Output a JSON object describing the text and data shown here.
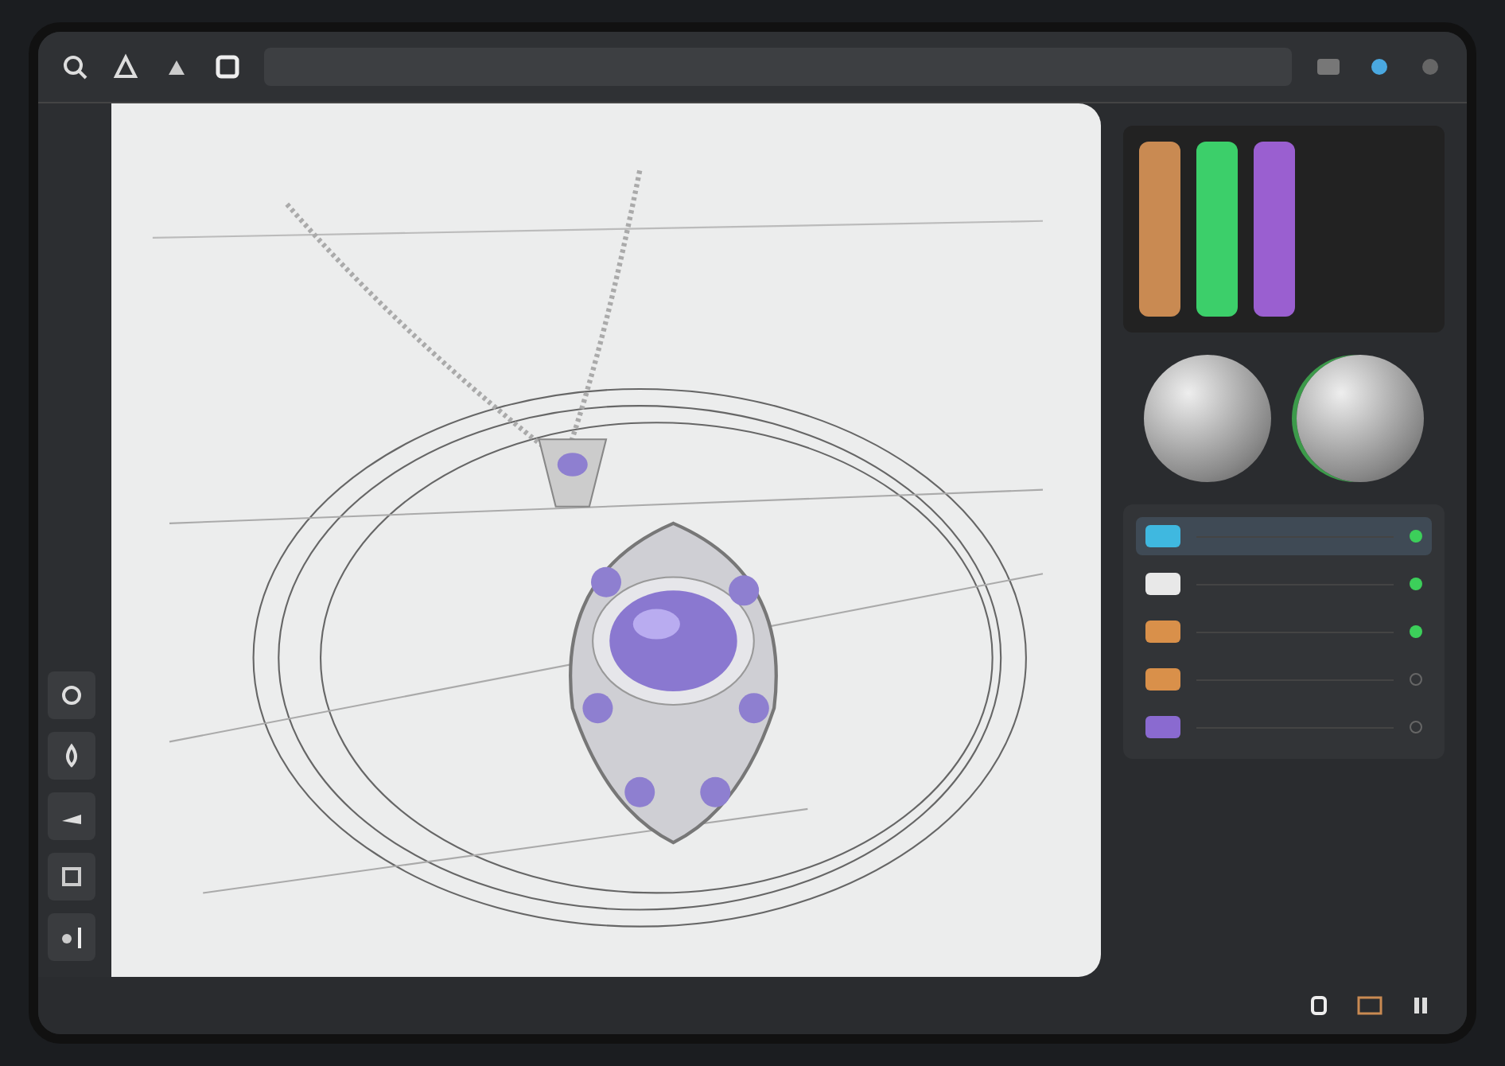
{
  "color_panel": {
    "bars": [
      {
        "color": "#c98a52"
      },
      {
        "color": "#3ccf6a"
      },
      {
        "color": "#9a5fd0"
      }
    ]
  },
  "layers": [
    {
      "color": "#3fb8e0",
      "visible": true,
      "selected": true
    },
    {
      "color": "#e8e8e8",
      "visible": true,
      "selected": false
    },
    {
      "color": "#d9904a",
      "visible": true,
      "selected": false
    },
    {
      "color": "#d9904a",
      "visible": false,
      "selected": false
    },
    {
      "color": "#8a6ad0",
      "visible": false,
      "selected": false
    }
  ]
}
